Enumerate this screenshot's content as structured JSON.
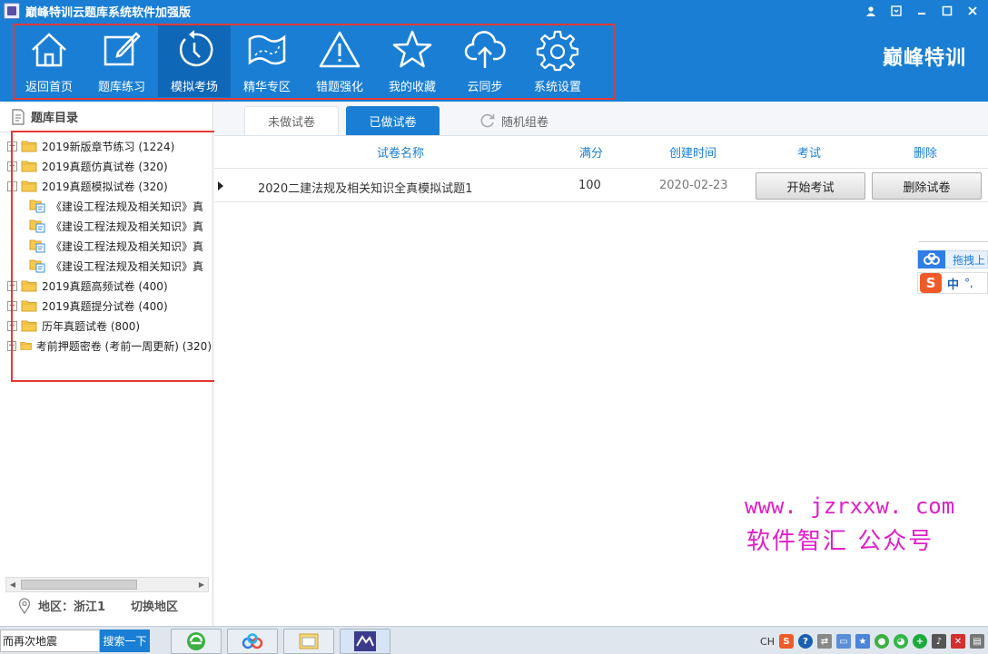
{
  "titlebar": {
    "title": "巅峰特训云题库系统软件加强版"
  },
  "toolbar": {
    "items": [
      {
        "label": "返回首页",
        "icon": "home-icon"
      },
      {
        "label": "题库练习",
        "icon": "edit-icon"
      },
      {
        "label": "模拟考场",
        "icon": "clock-icon"
      },
      {
        "label": "精华专区",
        "icon": "map-icon"
      },
      {
        "label": "错题强化",
        "icon": "warning-icon"
      },
      {
        "label": "我的收藏",
        "icon": "star-icon"
      },
      {
        "label": "云同步",
        "icon": "cloud-upload-icon"
      },
      {
        "label": "系统设置",
        "icon": "gear-icon"
      }
    ],
    "active_index": 2,
    "brand": "巅峰特训"
  },
  "left_panel": {
    "header": "题库目录",
    "tree": [
      {
        "label": "2019新版章节练习 (1224)",
        "level": 1,
        "expander": "+"
      },
      {
        "label": "2019真题仿真试卷 (320)",
        "level": 1,
        "expander": "+"
      },
      {
        "label": "2019真题模拟试卷 (320)",
        "level": 1,
        "expander": "-"
      },
      {
        "label": "《建设工程法规及相关知识》真",
        "level": 2
      },
      {
        "label": "《建设工程法规及相关知识》真",
        "level": 2
      },
      {
        "label": "《建设工程法规及相关知识》真",
        "level": 2
      },
      {
        "label": "《建设工程法规及相关知识》真",
        "level": 2
      },
      {
        "label": "2019真题高频试卷 (400)",
        "level": 1,
        "expander": "+"
      },
      {
        "label": "2019真题提分试卷 (400)",
        "level": 1,
        "expander": "+"
      },
      {
        "label": "历年真题试卷 (800)",
        "level": 1,
        "expander": "+"
      },
      {
        "label": "考前押题密卷 (考前一周更新) (320)",
        "level": 1,
        "expander": "+"
      }
    ],
    "region_label": "地区：浙江1",
    "switch_region": "切换地区"
  },
  "main": {
    "tabs": [
      {
        "label": "未做试卷"
      },
      {
        "label": "已做试卷"
      },
      {
        "label": "随机组卷"
      }
    ],
    "columns": {
      "name": "试卷名称",
      "score": "满分",
      "created": "创建时间",
      "exam": "考试",
      "delete": "删除"
    },
    "rows": [
      {
        "name": "2020二建法规及相关知识全真模拟试题1",
        "score": "100",
        "created": "2020-02-23",
        "exam_btn": "开始考试",
        "delete_btn": "删除试卷"
      }
    ]
  },
  "floating": {
    "baidu_label": "拖拽上",
    "ime_lang": "中",
    "ime_punct": "°,"
  },
  "watermark": {
    "url": "www. jzrxxw. com",
    "text": "软件智汇 公众号"
  },
  "taskbar": {
    "search_text": "而再次地震",
    "search_btn": "搜索一下",
    "tray_lang": "CH"
  },
  "colors": {
    "primary": "#1a7fd4",
    "active": "#0f67b8",
    "highlight_box": "#e53935",
    "watermark": "#e020c8"
  }
}
